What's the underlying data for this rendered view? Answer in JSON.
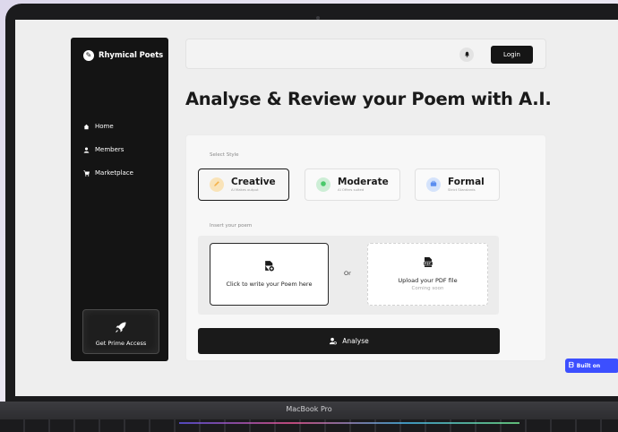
{
  "app": {
    "brand_name": "Rhymical Poets",
    "brand_icon": "feather-icon"
  },
  "sidebar": {
    "items": [
      {
        "label": "Home",
        "icon": "home-icon"
      },
      {
        "label": "Members",
        "icon": "user-icon"
      },
      {
        "label": "Marketplace",
        "icon": "cart-icon"
      }
    ],
    "prime_label": "Get Prime Access",
    "prime_icon": "rocket-icon"
  },
  "topbar": {
    "login_label": "Login",
    "bell_icon": "bell-icon"
  },
  "page_title": "Analyse & Review your Poem with A.I.",
  "style_section": {
    "label": "Select Style",
    "options": [
      {
        "name": "Creative",
        "sub": "AI Makes output",
        "icon": "pencil-icon",
        "color": "#f4b14a",
        "selected": true
      },
      {
        "name": "Moderate",
        "sub": "AI Offers suited",
        "icon": "circle-check-icon",
        "color": "#49c96b",
        "selected": false
      },
      {
        "name": "Formal",
        "sub": "Strict Standards",
        "icon": "briefcase-icon",
        "color": "#5a8df0",
        "selected": false
      }
    ]
  },
  "poem_section": {
    "label": "Insert your poem",
    "write_label": "Click to write your Poem here",
    "or_label": "Or",
    "upload_label": "Upload your PDF file",
    "upload_sub": "Coming soon"
  },
  "analyse_label": "Analyse",
  "device": {
    "label": "MacBook Pro"
  },
  "badge": {
    "label": "Built on"
  }
}
